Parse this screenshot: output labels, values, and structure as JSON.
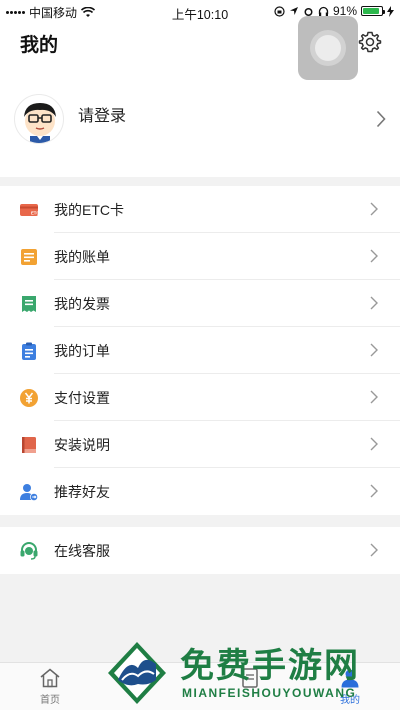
{
  "status_bar": {
    "carrier": "中国移动",
    "time": "上午10:10",
    "battery": "91%",
    "battery_level": 0.91
  },
  "header": {
    "title": "我的",
    "settings_icon": "gear-icon"
  },
  "profile": {
    "login_label": "请登录",
    "avatar_icon": "cartoon-avatar"
  },
  "menu": {
    "items": [
      {
        "label": "我的ETC卡",
        "icon": "etc-card-icon",
        "color": "#e8674a"
      },
      {
        "label": "我的账单",
        "icon": "bill-icon",
        "color": "#f2a233"
      },
      {
        "label": "我的发票",
        "icon": "invoice-icon",
        "color": "#3aa76d"
      },
      {
        "label": "我的订单",
        "icon": "order-icon",
        "color": "#3d7fe0"
      },
      {
        "label": "支付设置",
        "icon": "yuan-icon",
        "color": "#f2a233"
      },
      {
        "label": "安装说明",
        "icon": "book-icon",
        "color": "#e0654a"
      },
      {
        "label": "推荐好友",
        "icon": "user-add-icon",
        "color": "#3d7fe0"
      }
    ]
  },
  "service": {
    "label": "在线客服",
    "icon": "headset-icon",
    "color": "#3aa76d"
  },
  "tabbar": {
    "tabs": [
      {
        "label": "首页",
        "icon": "home-icon"
      },
      {
        "label": "",
        "icon": "discover-icon"
      },
      {
        "label": "",
        "icon": "record-icon"
      },
      {
        "label": "",
        "icon": "blank"
      },
      {
        "label": "我的",
        "icon": "user-icon"
      }
    ]
  },
  "watermark": {
    "title": "免费手游网",
    "subtitle": "MIANFEISHOUYOUWANG"
  }
}
